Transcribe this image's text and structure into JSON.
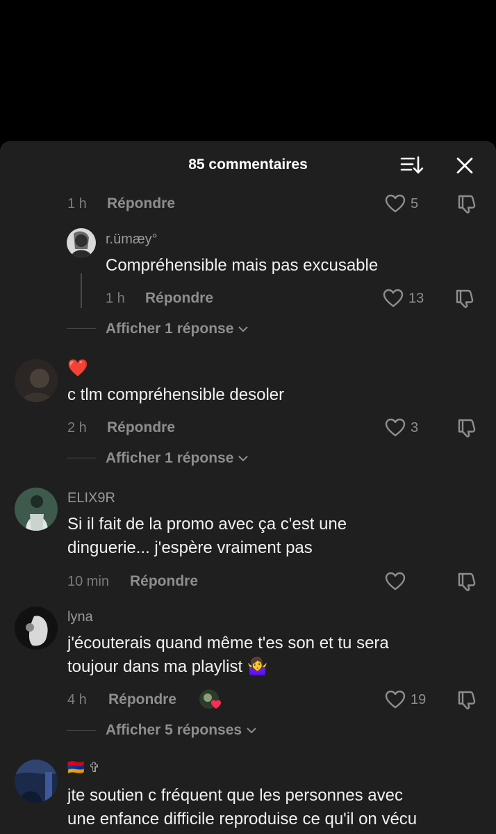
{
  "header": {
    "title": "85 commentaires"
  },
  "icons": {
    "sort": "sort-icon",
    "close": "close-icon",
    "like": "heart-icon",
    "dislike": "dislike-icon",
    "chevron": "chevron-down-icon"
  },
  "comments": [
    {
      "time": "1 h",
      "reply": "Répondre",
      "likes": "5"
    },
    {
      "username": "r.ümæy°",
      "text": "Compréhensible mais pas excusable",
      "time": "1 h",
      "reply": "Répondre",
      "likes": "13",
      "show_replies": "Afficher 1 réponse"
    },
    {
      "username": "❤️",
      "text": "c tlm compréhensible desoler",
      "time": "2 h",
      "reply": "Répondre",
      "likes": "3",
      "show_replies": "Afficher 1 réponse"
    },
    {
      "username": "ELIX9R",
      "text_lines": [
        "Si il fait de la promo avec ça c'est une",
        "dinguerie... j'espère vraiment pas"
      ],
      "time": "10 min",
      "reply": "Répondre",
      "likes": ""
    },
    {
      "username": "lyna",
      "text_lines": [
        "j'écouterais quand même t'es son et tu sera",
        "toujour dans ma playlist 🤷‍♀️"
      ],
      "time": "4 h",
      "reply": "Répondre",
      "likes": "19",
      "show_replies": "Afficher 5 réponses"
    },
    {
      "username": "🇦🇲 ✞",
      "text_lines": [
        "jte soutien c fréquent que les personnes avec",
        "une enfance difficile reproduise ce qu'il on vécu"
      ]
    }
  ],
  "colors": {
    "sheet": "#1f1f1f",
    "muted": "#8e8e8e",
    "text": "#f1f1f1",
    "heart_red": "#ff2d55"
  }
}
